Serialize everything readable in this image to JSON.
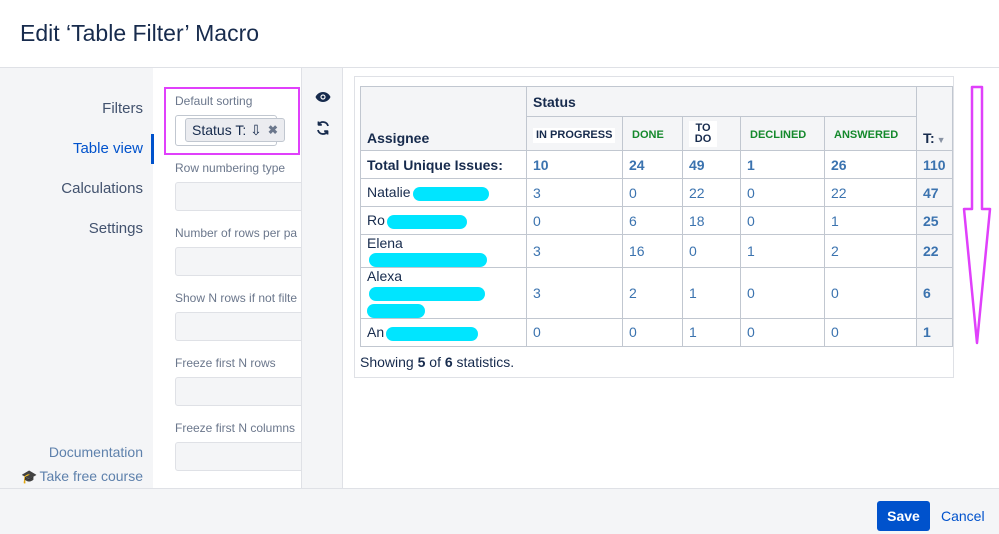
{
  "header": {
    "title": "Edit ‘Table Filter’ Macro"
  },
  "nav": {
    "items": [
      {
        "label": "Filters"
      },
      {
        "label": "Table view"
      },
      {
        "label": "Calculations"
      },
      {
        "label": "Settings"
      }
    ],
    "documentation": "Documentation",
    "course": "Take free course"
  },
  "form": {
    "default_sorting_label": "Default sorting",
    "default_sorting_chip": "Status T: ⇩",
    "row_numbering_label": "Row numbering type",
    "rows_per_page_label": "Number of rows per pa",
    "show_n_rows_label": "Show N rows if not filte",
    "freeze_rows_label": "Freeze first N rows",
    "freeze_cols_label": "Freeze first N columns"
  },
  "table": {
    "assignee_header": "Assignee",
    "status_header": "Status",
    "status_cols": [
      "IN PROGRESS",
      "DONE",
      "TO DO",
      "DECLINED",
      "ANSWERED"
    ],
    "total_header": "T:",
    "total_row_label": "Total Unique Issues:",
    "total_row_values": [
      "10",
      "24",
      "49",
      "1",
      "26",
      "110"
    ],
    "rows": [
      {
        "name": "Natalie",
        "values": [
          "3",
          "0",
          "22",
          "0",
          "22"
        ],
        "total": "47"
      },
      {
        "name": "Ro",
        "values": [
          "0",
          "6",
          "18",
          "0",
          "1"
        ],
        "total": "25"
      },
      {
        "name": "Elena",
        "values": [
          "3",
          "16",
          "0",
          "1",
          "2"
        ],
        "total": "22"
      },
      {
        "name": "Alexa",
        "values": [
          "3",
          "2",
          "1",
          "0",
          "0"
        ],
        "total": "6"
      },
      {
        "name": "An",
        "values": [
          "0",
          "0",
          "1",
          "0",
          "0"
        ],
        "total": "1"
      }
    ],
    "showing_prefix": "Showing ",
    "showing_count": "5",
    "showing_mid": " of ",
    "showing_total": "6",
    "showing_suffix": " statistics."
  },
  "footer": {
    "save": "Save",
    "cancel": "Cancel"
  },
  "colors": {
    "accent": "#0052cc",
    "highlight": "#e040fb",
    "redaction": "#00e5ff"
  }
}
